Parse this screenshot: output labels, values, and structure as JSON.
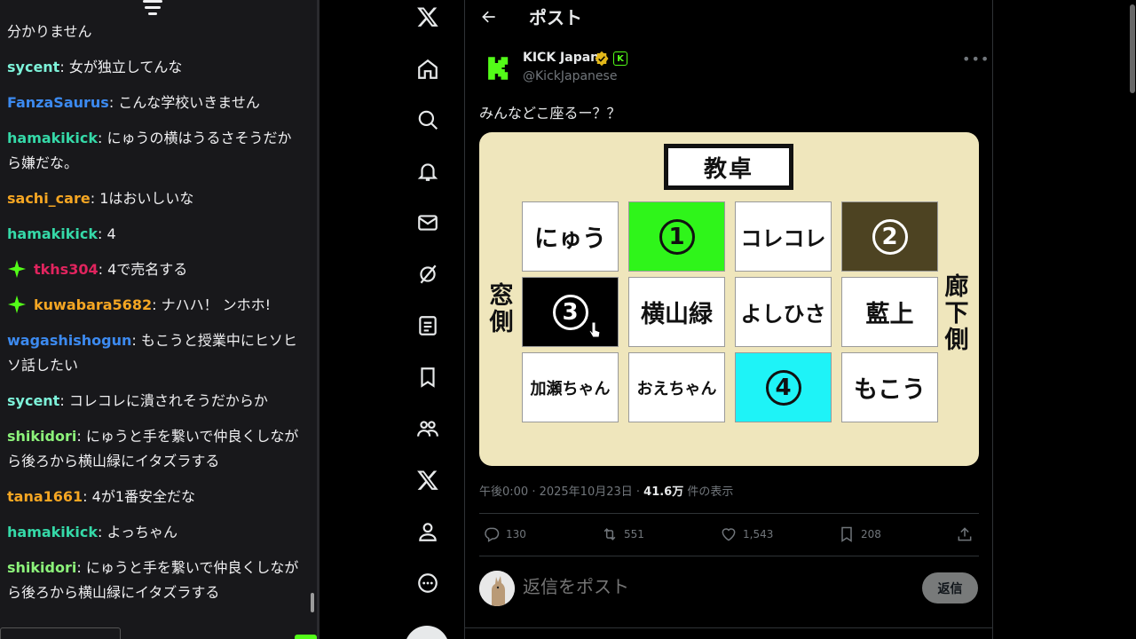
{
  "chat": {
    "messages": [
      {
        "user": "",
        "text": "分かりません",
        "color": "#efeff1",
        "badge": false
      },
      {
        "user": "sycent",
        "text": "女が独立してんな",
        "color": "#7df2d9",
        "badge": false
      },
      {
        "user": "FanzaSaurus",
        "text": "こんな学校いきません",
        "color": "#3c8af0",
        "badge": false
      },
      {
        "user": "hamakikick",
        "text": "にゅうの横はうるさそうだから嫌だな。",
        "color": "#35d9a8",
        "badge": false
      },
      {
        "user": "sachi_care",
        "text": "1はおいしいな",
        "color": "#f5a623",
        "badge": false
      },
      {
        "user": "hamakikick",
        "text": "4",
        "color": "#35d9a8",
        "badge": false
      },
      {
        "user": "tkhs304",
        "text": "4で売名する",
        "color": "#e0245e",
        "badge": true
      },
      {
        "user": "kuwabara5682",
        "text": "ナハハ！ ンホホ!",
        "color": "#f5a623",
        "badge": true
      },
      {
        "user": "wagashishogun",
        "text": "もこうと授業中にヒソヒソ話したい",
        "color": "#3c8af0",
        "badge": false
      },
      {
        "user": "sycent",
        "text": "コレコレに潰されそうだからか",
        "color": "#7df2d9",
        "badge": false
      },
      {
        "user": "shikidori",
        "text": "にゅうと手を繋いで仲良くしながら後ろから横山緑にイタズラする",
        "color": "#8cf27a",
        "badge": false
      },
      {
        "user": "tana1661",
        "text": "4が1番安全だな",
        "color": "#f5a623",
        "badge": false
      },
      {
        "user": "hamakikick",
        "text": "よっちゃん",
        "color": "#35d9a8",
        "badge": false
      },
      {
        "user": "shikidori",
        "text": "にゅうと手を繋いで仲良くしながら後ろから横山緑にイタズラする",
        "color": "#8cf27a",
        "badge": false
      }
    ]
  },
  "nav": {
    "items": [
      "x-logo-icon",
      "home-icon",
      "search-icon",
      "notifications-icon",
      "messages-icon",
      "grok-icon",
      "lists-icon",
      "bookmarks-icon",
      "communities-icon",
      "premium-icon",
      "profile-icon",
      "more-icon"
    ]
  },
  "header": {
    "title": "ポスト"
  },
  "post": {
    "author_name": "KICK Japan",
    "author_handle": "@KickJapanese",
    "badge_letter": "K",
    "text": "みんなどこ座るー？？",
    "image": {
      "teacher_desk": "教卓",
      "window_side": "窓側",
      "hallway_side": "廊下側",
      "seats": [
        {
          "label": "にゅう",
          "bg": "#ffffff",
          "fg": "#111111",
          "circle": false
        },
        {
          "label": "1",
          "bg": "#2ff51a",
          "fg": "#111111",
          "circle": true
        },
        {
          "label": "コレコレ",
          "bg": "#ffffff",
          "fg": "#111111",
          "circle": false
        },
        {
          "label": "2",
          "bg": "#4d4322",
          "fg": "#ffffff",
          "circle": true
        },
        {
          "label": "3",
          "bg": "#000000",
          "fg": "#ffffff",
          "circle": true
        },
        {
          "label": "横山緑",
          "bg": "#ffffff",
          "fg": "#111111",
          "circle": false
        },
        {
          "label": "よしひさ",
          "bg": "#ffffff",
          "fg": "#111111",
          "circle": false
        },
        {
          "label": "藍上",
          "bg": "#ffffff",
          "fg": "#111111",
          "circle": false
        },
        {
          "label": "加瀬ちゃん",
          "bg": "#ffffff",
          "fg": "#111111",
          "circle": false
        },
        {
          "label": "おえちゃん",
          "bg": "#ffffff",
          "fg": "#111111",
          "circle": false
        },
        {
          "label": "4",
          "bg": "#1ef3f7",
          "fg": "#111111",
          "circle": true
        },
        {
          "label": "もこう",
          "bg": "#ffffff",
          "fg": "#111111",
          "circle": false
        }
      ]
    },
    "meta": {
      "time": "午後0:00 · 2025年10月23日 · ",
      "views": "41.6万",
      "views_suffix": " 件の表示"
    },
    "stats": {
      "replies": "130",
      "reposts": "551",
      "likes": "1,543",
      "bookmarks": "208"
    }
  },
  "reply": {
    "placeholder": "返信をポスト",
    "button_label": "返信"
  },
  "colors": {
    "kick_green": "#53fc18",
    "chart_bg": "#efe6bc",
    "verified_gold": "#e2b719"
  }
}
